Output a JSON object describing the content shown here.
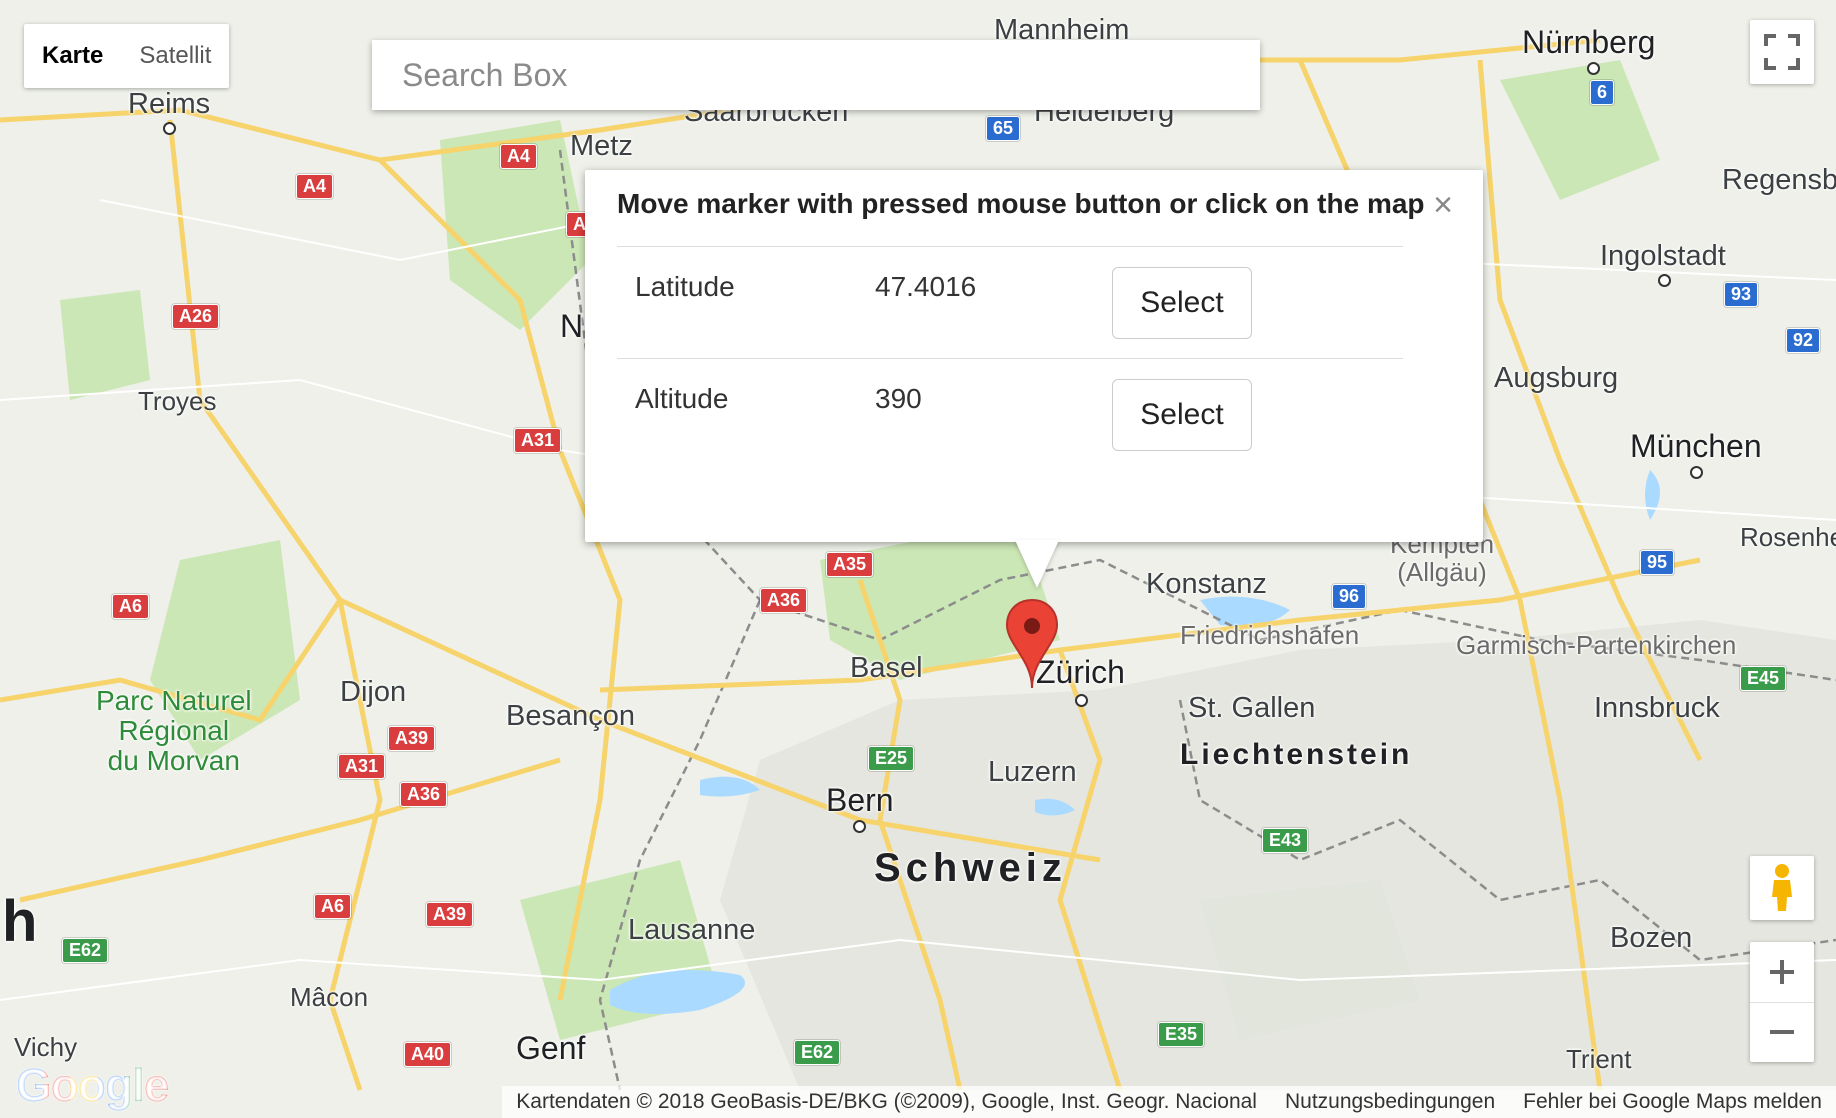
{
  "map_type": {
    "map_label": "Karte",
    "satellite_label": "Satellit"
  },
  "search": {
    "placeholder": "Search Box"
  },
  "info_window": {
    "title": "Move marker with pressed mouse button or click on the map",
    "close_glyph": "×",
    "rows": [
      {
        "label": "Latitude",
        "value": "47.4016",
        "button": "Select"
      },
      {
        "label": "Altitude",
        "value": "390",
        "button": "Select"
      }
    ]
  },
  "places": {
    "nurnberg": "Nürnberg",
    "mannheim": "Mannheim",
    "saarbrucken": "Saarbrücken",
    "heidelberg": "Heidelberg",
    "reims": "Reims",
    "metz": "Metz",
    "regensburg": "Regensb",
    "ingolstadt": "Ingolstadt",
    "troyes": "Troyes",
    "augsburg": "Augsburg",
    "munchen": "München",
    "rosenheim": "Rosenhe",
    "kempten": "Kempten\n(Allgäu)",
    "konstanz": "Konstanz",
    "friedrichshafen": "Friedrichshafen",
    "garmisch": "Garmisch-Partenkirchen",
    "basel": "Basel",
    "zurich": "Zürich",
    "stgallen": "St. Gallen",
    "innsbruck": "Innsbruck",
    "liechtenstein": "Liechtenstein",
    "dijon": "Dijon",
    "besancon": "Besançon",
    "park": "Parc Naturel\nRégional\ndu Morvan",
    "luzern": "Luzern",
    "bern": "Bern",
    "schweiz": "Schweiz",
    "lausanne": "Lausanne",
    "bozen": "Bozen",
    "macon": "Mâcon",
    "vichy": "Vichy",
    "genf": "Genf",
    "trient": "Trient",
    "n_partial": "N",
    "h_partial": "h"
  },
  "road_shields": [
    {
      "label": "A4",
      "color": "red"
    },
    {
      "label": "A4",
      "color": "red"
    },
    {
      "label": "A",
      "color": "red"
    },
    {
      "label": "65",
      "color": "blue"
    },
    {
      "label": "6",
      "color": "blue"
    },
    {
      "label": "A26",
      "color": "red"
    },
    {
      "label": "A31",
      "color": "red"
    },
    {
      "label": "93",
      "color": "blue"
    },
    {
      "label": "92",
      "color": "blue"
    },
    {
      "label": "A35",
      "color": "red"
    },
    {
      "label": "A36",
      "color": "red"
    },
    {
      "label": "96",
      "color": "blue"
    },
    {
      "label": "95",
      "color": "blue"
    },
    {
      "label": "A6",
      "color": "red"
    },
    {
      "label": "E45",
      "color": "green"
    },
    {
      "label": "A39",
      "color": "red"
    },
    {
      "label": "A31",
      "color": "red"
    },
    {
      "label": "A36",
      "color": "red"
    },
    {
      "label": "E25",
      "color": "green"
    },
    {
      "label": "E43",
      "color": "green"
    },
    {
      "label": "A6",
      "color": "red"
    },
    {
      "label": "A39",
      "color": "red"
    },
    {
      "label": "E62",
      "color": "green"
    },
    {
      "label": "A40",
      "color": "red"
    },
    {
      "label": "E62",
      "color": "green"
    },
    {
      "label": "E35",
      "color": "green"
    }
  ],
  "footer": {
    "attribution": "Kartendaten © 2018 GeoBasis-DE/BKG (©2009), Google, Inst. Geogr. Nacional",
    "terms": "Nutzungsbedingungen",
    "report": "Fehler bei Google Maps melden"
  },
  "logo_text": "Google",
  "colors": {
    "marker": "#ea4335",
    "highway": "#f6d36b",
    "water": "#aadaff",
    "forest": "#c8e6b0"
  },
  "icons": [
    "fullscreen-icon",
    "pegman-icon",
    "zoom-in-icon",
    "zoom-out-icon",
    "close-icon",
    "map-marker-icon"
  ]
}
